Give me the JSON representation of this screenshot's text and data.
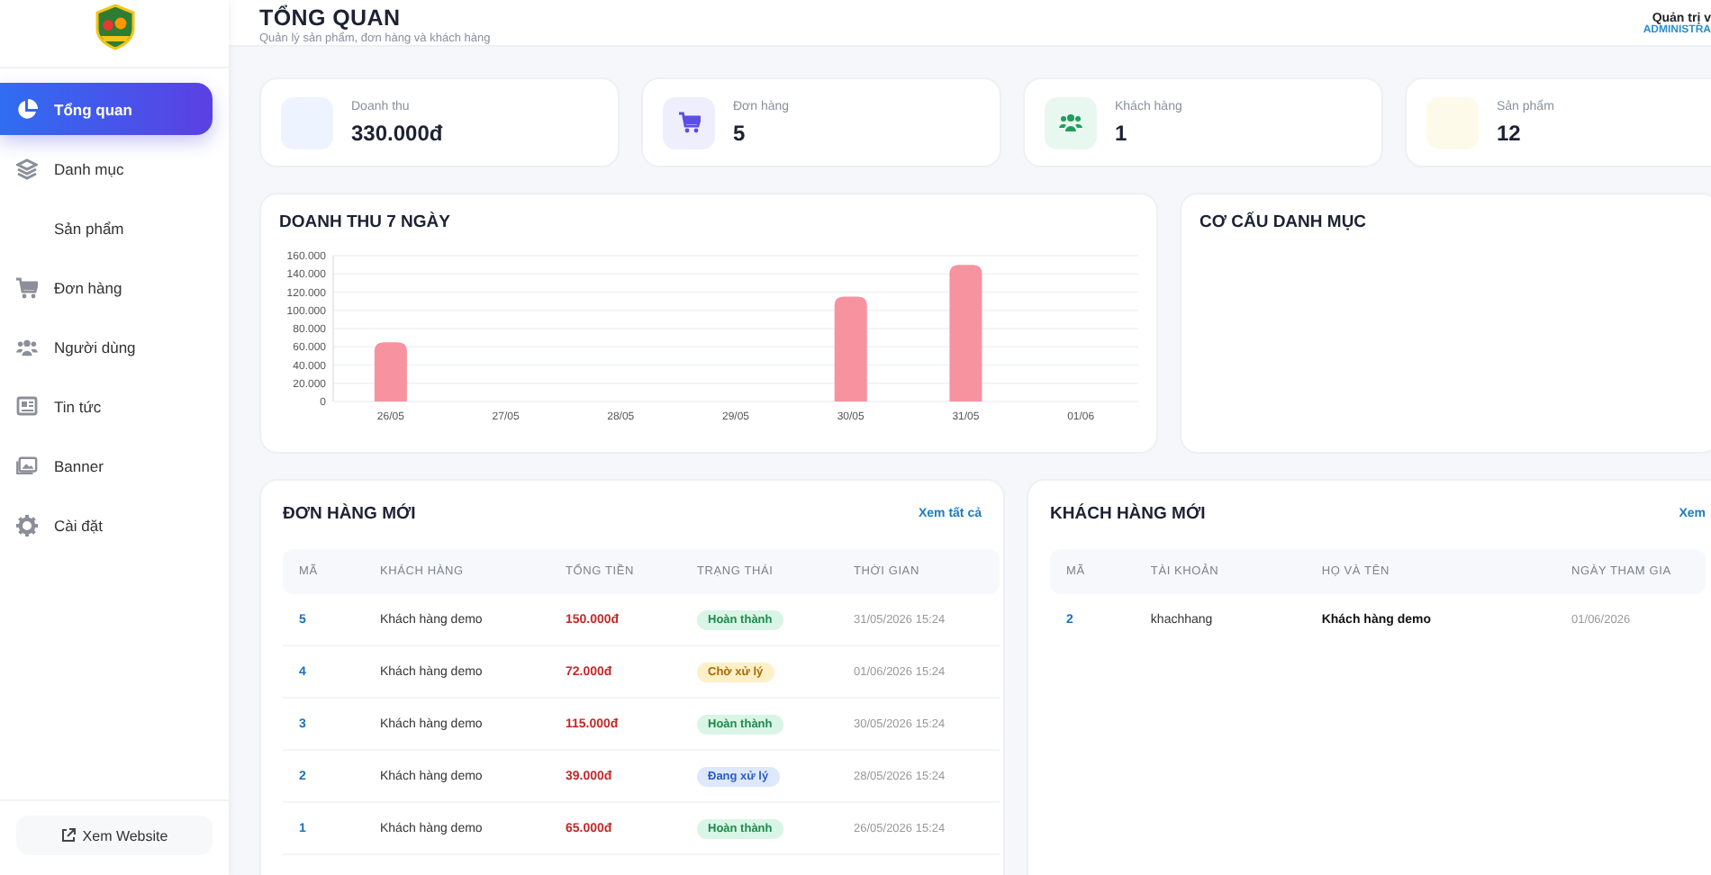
{
  "header": {
    "title": "TỔNG QUAN",
    "subtitle": "Quản lý sản phẩm, đơn hàng và khách hàng",
    "user_name": "Quản trị v",
    "user_role": "ADMINISTRA"
  },
  "sidebar": {
    "items": [
      {
        "label": "Tổng quan",
        "selected": true
      },
      {
        "label": "Danh mục",
        "selected": false
      },
      {
        "label": "Sản phẩm",
        "selected": false
      },
      {
        "label": "Đơn hàng",
        "selected": false
      },
      {
        "label": "Người dùng",
        "selected": false
      },
      {
        "label": "Tin tức",
        "selected": false
      },
      {
        "label": "Banner",
        "selected": false
      },
      {
        "label": "Cài đặt",
        "selected": false
      }
    ],
    "footer_link": "Xem Website"
  },
  "stats": [
    {
      "label": "Doanh thu",
      "value": "330.000đ",
      "color": "#eef4ff"
    },
    {
      "label": "Đơn hàng",
      "value": "5",
      "color": "#eeeefd"
    },
    {
      "label": "Khách hàng",
      "value": "1",
      "color": "#e8f8f0"
    },
    {
      "label": "Sản phẩm",
      "value": "12",
      "color": "#fefaea"
    }
  ],
  "revenue_panel": {
    "title": "DOANH THU 7 NGÀY",
    "chart_data": {
      "type": "bar",
      "categories": [
        "26/05",
        "27/05",
        "28/05",
        "29/05",
        "30/05",
        "31/05",
        "01/06"
      ],
      "grid": true,
      "series": [
        {
          "color": "#f7929f",
          "values": [
            65000,
            0,
            0,
            0,
            115000,
            150000,
            0
          ]
        }
      ],
      "ylim": [
        0,
        160000
      ],
      "yticks": [
        {
          "value": 0,
          "label": "0"
        },
        {
          "value": 20000,
          "label": "20.000"
        },
        {
          "value": 40000,
          "label": "40.000"
        },
        {
          "value": 60000,
          "label": "60.000"
        },
        {
          "value": 80000,
          "label": "80.000"
        },
        {
          "value": 100000,
          "label": "100.000"
        },
        {
          "value": 120000,
          "label": "120.000"
        },
        {
          "value": 140000,
          "label": "140.000"
        },
        {
          "value": 160000,
          "label": "160.000"
        }
      ]
    }
  },
  "category_panel": {
    "title": "CƠ CẤU DANH MỤC"
  },
  "orders_panel": {
    "title": "ĐƠN HÀNG MỚI",
    "link": "Xem tất cả",
    "columns": [
      "MÃ",
      "KHÁCH HÀNG",
      "TỔNG TIỀN",
      "TRẠNG THÁI",
      "THỜI GIAN"
    ],
    "rows": [
      {
        "id": "5",
        "customer": "Khách hàng demo",
        "total": "150.000đ",
        "status": "Hoàn thành",
        "kind": "done",
        "time": "31/05/2026 15:24"
      },
      {
        "id": "4",
        "customer": "Khách hàng demo",
        "total": "72.000đ",
        "status": "Chờ xử lý",
        "kind": "pending",
        "time": "01/06/2026 15:24"
      },
      {
        "id": "3",
        "customer": "Khách hàng demo",
        "total": "115.000đ",
        "status": "Hoàn thành",
        "kind": "done",
        "time": "30/05/2026 15:24"
      },
      {
        "id": "2",
        "customer": "Khách hàng demo",
        "total": "39.000đ",
        "status": "Đang xử lý",
        "kind": "processing",
        "time": "28/05/2026 15:24"
      },
      {
        "id": "1",
        "customer": "Khách hàng demo",
        "total": "65.000đ",
        "status": "Hoàn thành",
        "kind": "done",
        "time": "26/05/2026 15:24"
      }
    ]
  },
  "customers_panel": {
    "title": "KHÁCH HÀNG MỚI",
    "link": "Xem",
    "columns": [
      "MÃ",
      "TÀI KHOẢN",
      "HỌ VÀ TÊN",
      "NGÀY THAM GIA"
    ],
    "rows": [
      {
        "id": "2",
        "username": "khachhang",
        "full_name": "Khách hàng demo",
        "joined": "01/06/2026"
      }
    ]
  }
}
